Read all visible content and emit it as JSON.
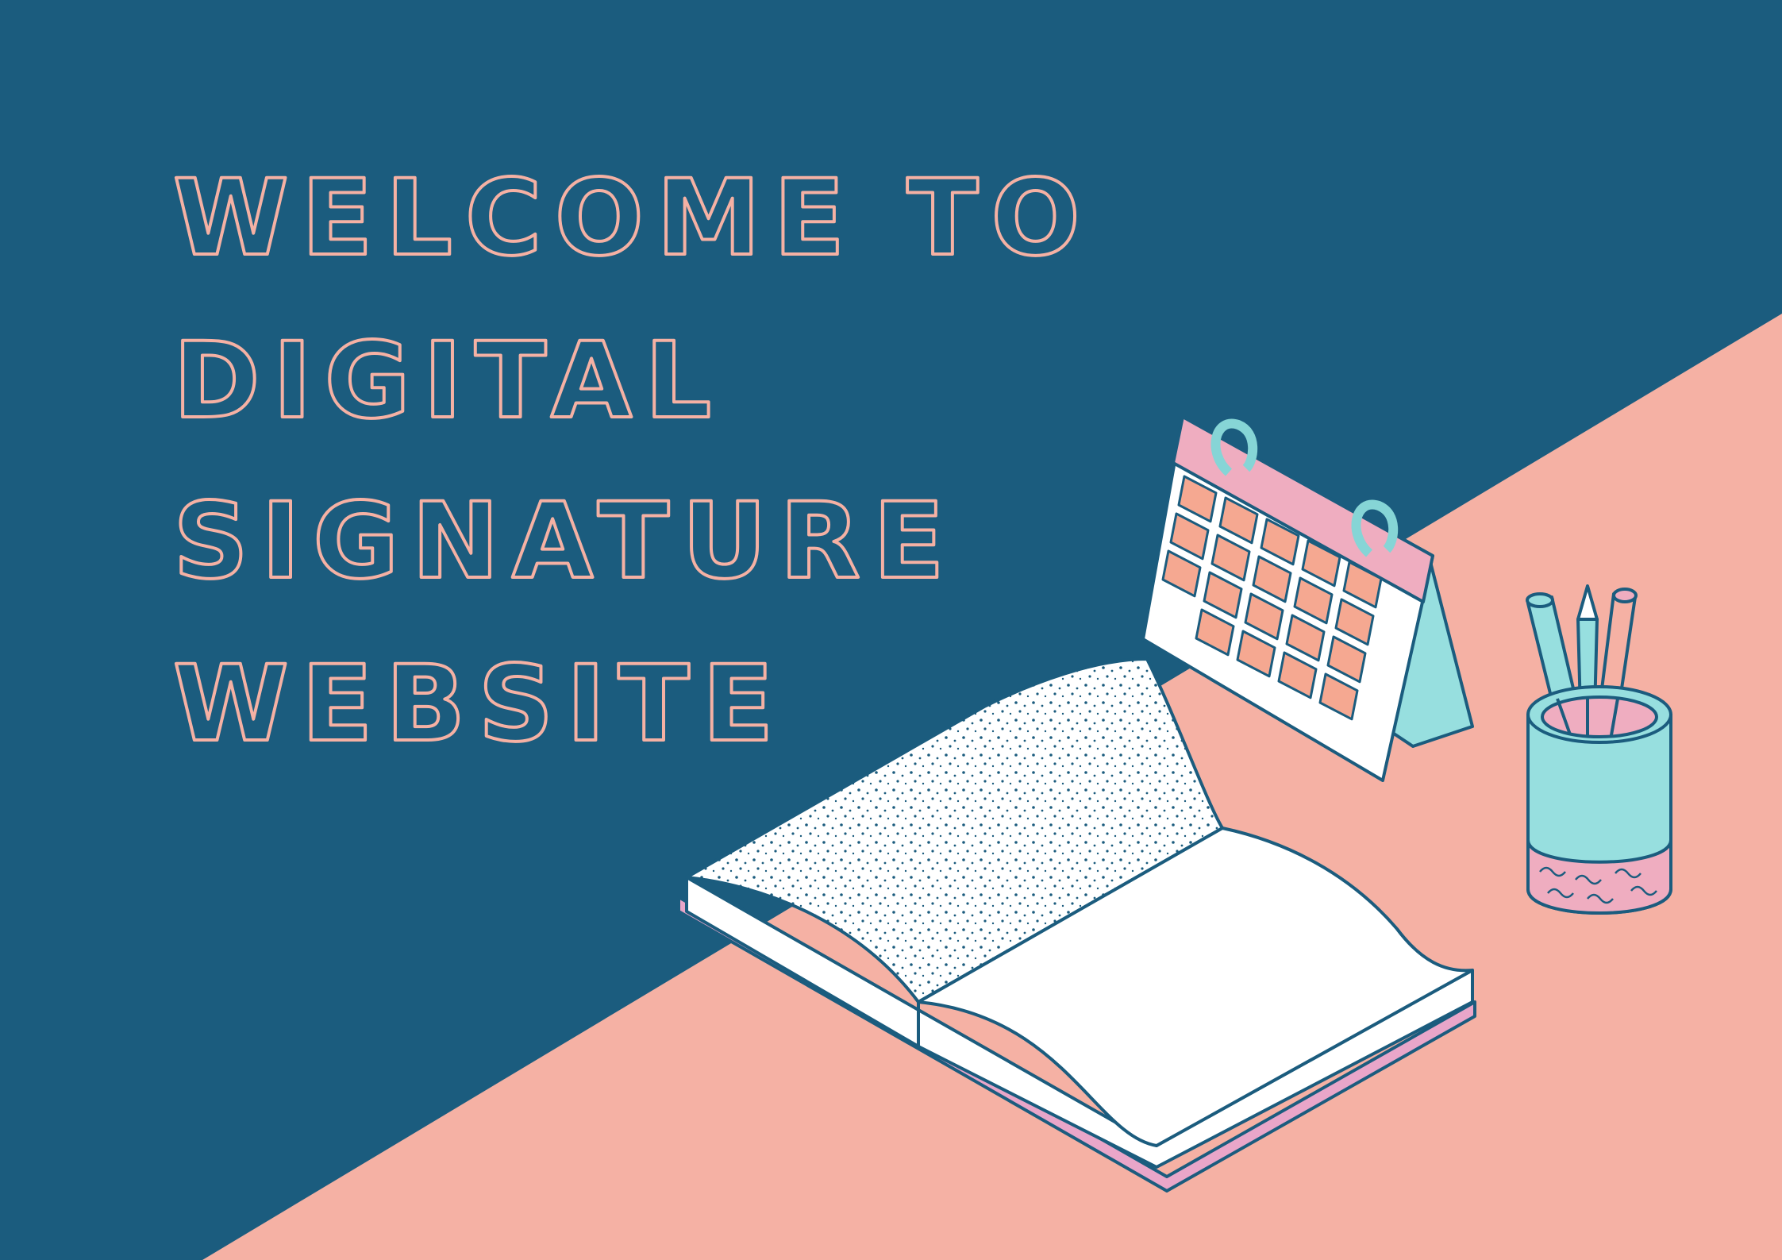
{
  "headline": {
    "lines": [
      "WELCOME TO",
      "DIGITAL",
      "SIGNATURE",
      "WEBSITE"
    ]
  },
  "colors": {
    "background_blue": "#1b5c7e",
    "desk_peach": "#f5b1a4",
    "headline_outline": "#f5b1a4",
    "outline_navy": "#1b5c7e",
    "calendar_header_pink": "#efadc0",
    "calendar_cell_salmon": "#f5a891",
    "calendar_ring_mint": "#86d5d6",
    "mint": "#97dfdf",
    "book_cover_pink": "#e9a6c9",
    "paper_white": "#ffffff"
  },
  "illustration": {
    "objects": [
      "open-book",
      "desk-calendar",
      "pencil-cup"
    ]
  }
}
